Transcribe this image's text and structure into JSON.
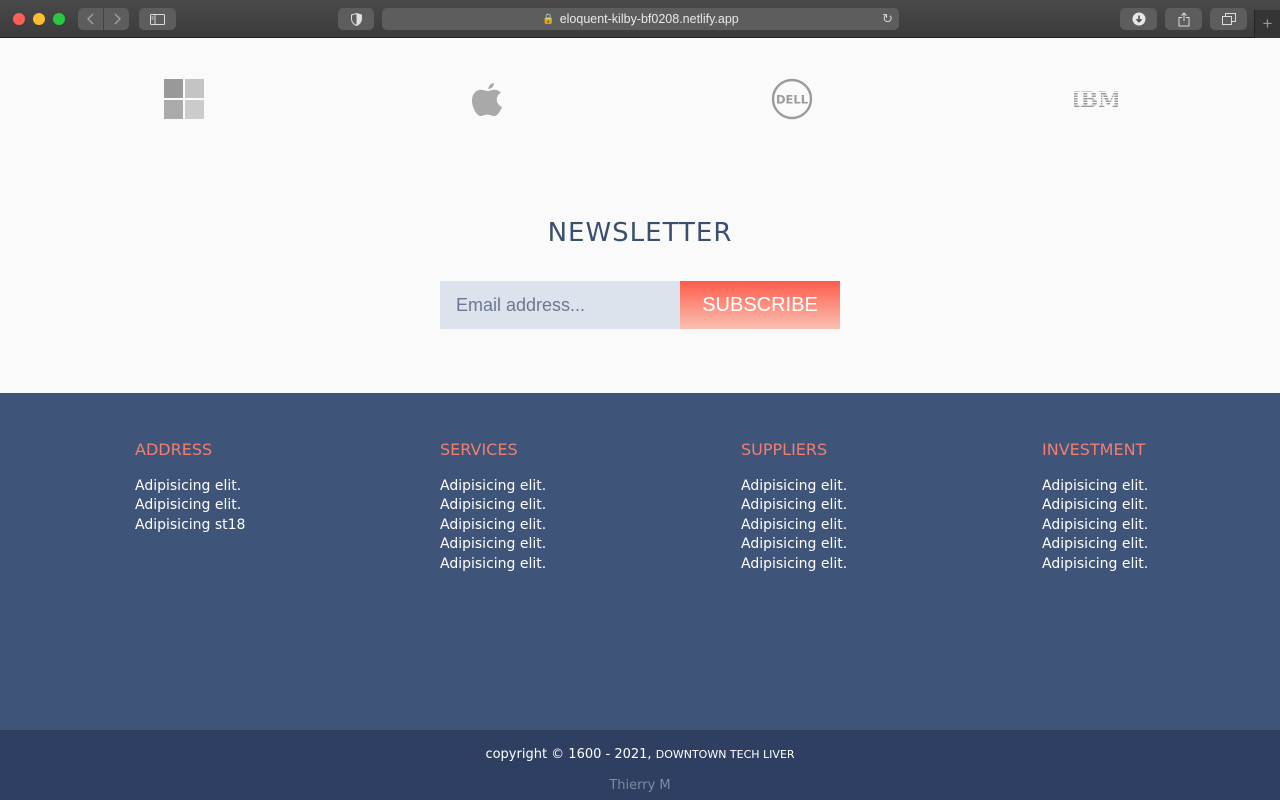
{
  "browser": {
    "url": "eloquent-kilby-bf0208.netlify.app",
    "icons": {
      "back": "chevron-left-icon",
      "forward": "chevron-right-icon",
      "sidebar": "sidebar-icon",
      "privacy": "shield-icon",
      "lock": "lock-icon",
      "reload": "reload-icon",
      "download": "download-icon",
      "share": "share-icon",
      "tabs": "tabs-overview-icon",
      "new_tab": "plus-icon"
    }
  },
  "logos": {
    "microsoft": "windows-logo",
    "apple": "apple-logo",
    "dell": "DELL",
    "ibm": "IBM"
  },
  "newsletter": {
    "title": "NEWSLETTER",
    "email_placeholder": "Email address...",
    "subscribe_label": "SUBSCRIBE"
  },
  "footer": {
    "columns": [
      {
        "heading": "ADDRESS",
        "items": [
          "Adipisicing elit.",
          "Adipisicing elit.",
          "Adipisicing st18"
        ]
      },
      {
        "heading": "SERVICES",
        "items": [
          "Adipisicing elit.",
          "Adipisicing elit.",
          "Adipisicing elit.",
          "Adipisicing elit.",
          "Adipisicing elit."
        ]
      },
      {
        "heading": "SUPPLIERS",
        "items": [
          "Adipisicing elit.",
          "Adipisicing elit.",
          "Adipisicing elit.",
          "Adipisicing elit.",
          "Adipisicing elit."
        ]
      },
      {
        "heading": "INVESTMENT",
        "items": [
          "Adipisicing elit.",
          "Adipisicing elit.",
          "Adipisicing elit.",
          "Adipisicing elit.",
          "Adipisicing elit."
        ]
      }
    ],
    "copyright": "copyright © 1600 - 2021,",
    "brand": "DOWNTOWN TECH LIVER",
    "author": "Thierry M"
  },
  "colors": {
    "footer_bg": "#3f5479",
    "bottom_bar_bg": "#2f3f61",
    "heading_accent": "#f37e6d",
    "subscribe_gradient_top": "#ff5c4c",
    "subscribe_gradient_bottom": "#f9c1b2",
    "input_bg": "#dde3ec",
    "newsletter_title": "#3a4e6e"
  }
}
